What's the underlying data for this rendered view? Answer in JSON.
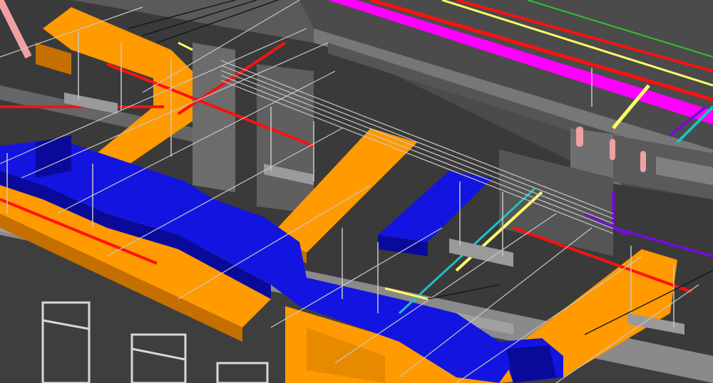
{
  "scene": {
    "subject": "mep-coordination-model",
    "colors": {
      "background": "#3a3a3a",
      "concrete_dark": "#4a4a4a",
      "concrete_mid": "#6a6a6a",
      "concrete_light": "#8c8c8c",
      "slab_top": "#9a9a9a",
      "supply_duct": "#ff9a00",
      "supply_duct_shade": "#c46f00",
      "return_duct": "#1414e0",
      "return_duct_shade": "#0a0a9a",
      "magenta_pipe": "#ff00ff",
      "red_pipe": "#ff1010",
      "yellow_pipe": "#ffff66",
      "cyan_pipe": "#20c0c0",
      "green_pipe": "#30c030",
      "purple_pipe": "#7010d0",
      "hanger_rod": "#c8c8c8",
      "salmon_pipe": "#f0a0a0",
      "window_frame": "#d8d8d8"
    }
  }
}
